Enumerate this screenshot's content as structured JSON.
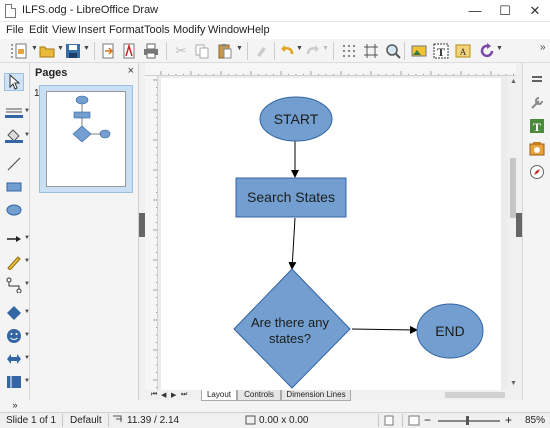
{
  "window": {
    "title": "ILFS.odg - LibreOffice Draw",
    "minimize": "—",
    "maximize": "☐",
    "close": "✕"
  },
  "menu": [
    "File",
    "Edit",
    "View",
    "Insert",
    "Format",
    "Tools",
    "Modify",
    "Window",
    "Help"
  ],
  "pages_panel": {
    "title": "Pages",
    "close": "×",
    "page_number": "1"
  },
  "flowchart": {
    "start": "START",
    "process": "Search States",
    "decision_line1": "Are there any",
    "decision_line2": "states?",
    "end": "END",
    "shape_fill": "#729fcf",
    "shape_stroke": "#3465a4"
  },
  "tabs": [
    "Layout",
    "Controls",
    "Dimension Lines"
  ],
  "status": {
    "slide": "Slide 1 of 1",
    "layout": "Default",
    "position": "11.39 / 2.14",
    "size": "0.00 x 0.00",
    "zoom": "85%"
  },
  "sidebar_more": "»",
  "bottom_more": "»"
}
